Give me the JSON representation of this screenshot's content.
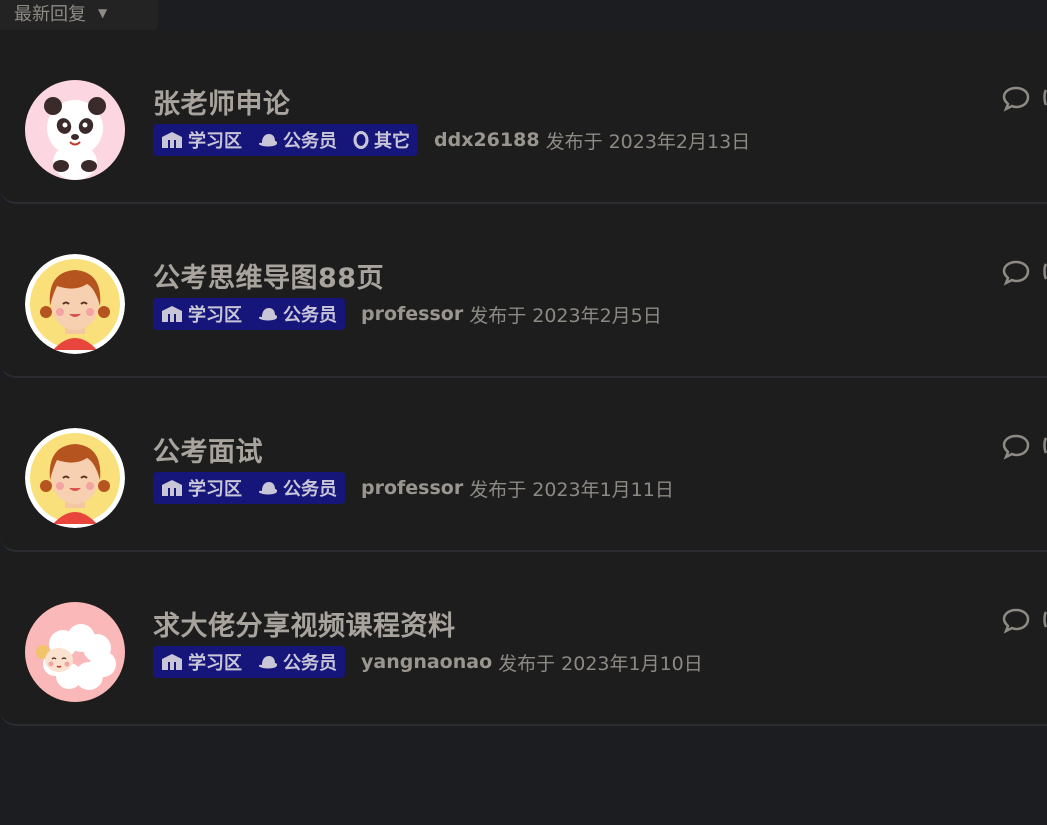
{
  "sort": {
    "label": "最新回复",
    "icon": "chevron-down-icon"
  },
  "topics": [
    {
      "title": "张老师申论",
      "avatar": "panda",
      "tags": [
        {
          "icon": "building-icon",
          "label": "学习区"
        },
        {
          "icon": "hat-icon",
          "label": "公务员"
        },
        {
          "icon": "circle-icon",
          "label": "其它"
        }
      ],
      "author": "ddx26188",
      "posted_prefix": "发布于",
      "date": "2023年2月13日"
    },
    {
      "title": "公考思维导图88页",
      "avatar": "girl",
      "tags": [
        {
          "icon": "building-icon",
          "label": "学习区"
        },
        {
          "icon": "hat-icon",
          "label": "公务员"
        }
      ],
      "author": "professor",
      "posted_prefix": "发布于",
      "date": "2023年2月5日"
    },
    {
      "title": "公考面试",
      "avatar": "girl",
      "tags": [
        {
          "icon": "building-icon",
          "label": "学习区"
        },
        {
          "icon": "hat-icon",
          "label": "公务员"
        }
      ],
      "author": "professor",
      "posted_prefix": "发布于",
      "date": "2023年1月11日"
    },
    {
      "title": "求大佬分享视频课程资料",
      "avatar": "sheep",
      "tags": [
        {
          "icon": "building-icon",
          "label": "学习区"
        },
        {
          "icon": "hat-icon",
          "label": "公务员"
        }
      ],
      "author": "yangnaonao",
      "posted_prefix": "发布于",
      "date": "2023年1月10日"
    }
  ],
  "colors": {
    "background": "#1c1d20",
    "tag_bg": "#15157a",
    "title": "#a8a49d"
  }
}
